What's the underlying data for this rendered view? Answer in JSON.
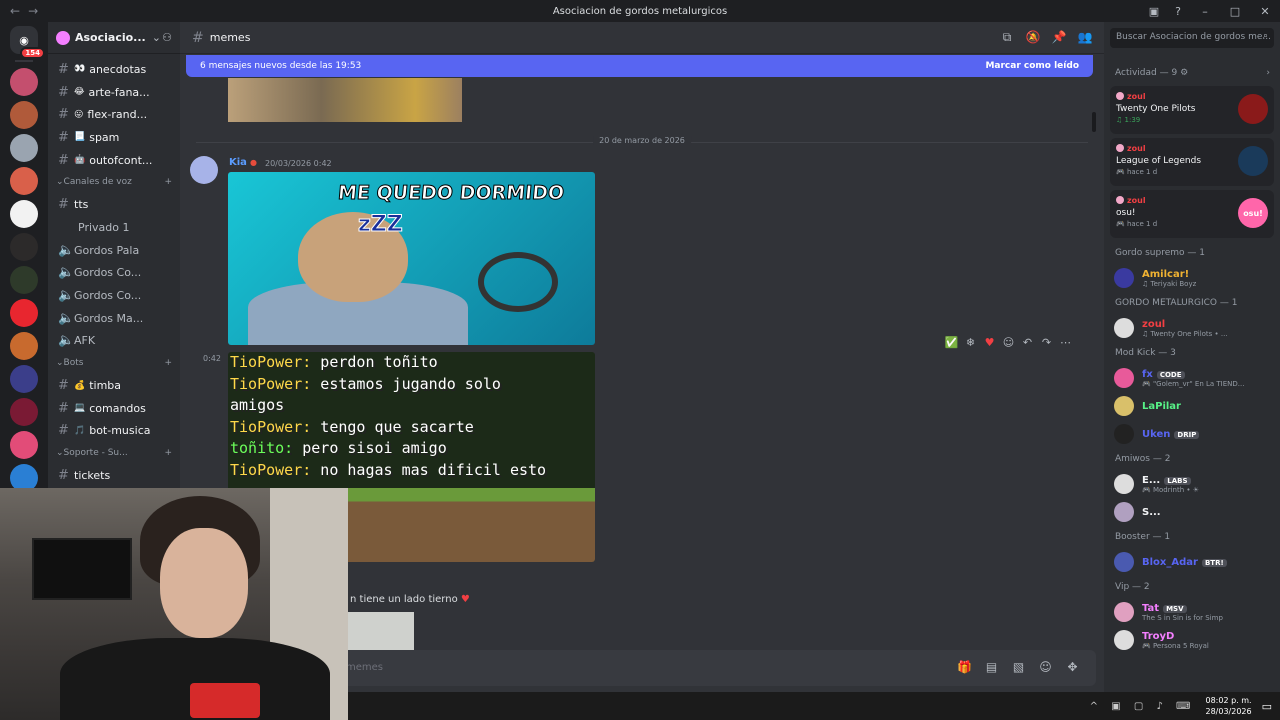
{
  "window": {
    "title": "Asociacion de gordos metalurgicos",
    "nav_back": "←",
    "nav_forward": "→"
  },
  "guilds": {
    "home_badge": "154",
    "colors": [
      "#c44f6e",
      "#b05a3a",
      "#9aa4b0",
      "#d9604a",
      "#f2f2f2",
      "#2c2a2a",
      "#2e3a2a",
      "#e8262f",
      "#c86a2e",
      "#3b3e8a",
      "#7a1a34",
      "#e24c78",
      "#2a7fd4"
    ]
  },
  "server": {
    "name": "Asociacio...",
    "channels": [
      {
        "emoji": "👀",
        "name": "anecdotas"
      },
      {
        "emoji": "😂",
        "name": "arte-fana..."
      },
      {
        "emoji": "😛",
        "name": "flex-rand..."
      },
      {
        "emoji": "📃",
        "name": "spam"
      },
      {
        "emoji": "🤖",
        "name": "outofcont..."
      }
    ],
    "voice_category": "Canales de voz",
    "voice_channels": [
      {
        "name": "tts",
        "type": "text"
      },
      {
        "name": "Privado 1",
        "type": "plain"
      },
      {
        "name": "Gordos Pala",
        "type": "voice"
      },
      {
        "name": "Gordos Co...",
        "type": "voice"
      },
      {
        "name": "Gordos Co...",
        "type": "voice"
      },
      {
        "name": "Gordos Ma...",
        "type": "voice"
      },
      {
        "name": "AFK",
        "type": "voice"
      }
    ],
    "bots_category": "Bots",
    "bots_channels": [
      {
        "emoji": "💰",
        "name": "timba"
      },
      {
        "emoji": "💻",
        "name": "comandos"
      },
      {
        "emoji": "🎵",
        "name": "bot-musica"
      }
    ],
    "support_category": "Soporte - Su...",
    "support_channels": [
      {
        "name": "tickets"
      }
    ]
  },
  "channel": {
    "name": "memes",
    "new_messages_text": "6 mensajes nuevos desde las 19:53",
    "mark_read": "Marcar como leído",
    "date_divider": "20 de marzo de 2026",
    "author": "Kia",
    "timestamp": "20/03/2026 0:42",
    "short_time": "0:42",
    "meme1_caption": "ME QUEDO DORMIDO",
    "meme1_zzz": "zZZ",
    "chat_lines": [
      {
        "name": "TioPower:",
        "text": " perdon toñito"
      },
      {
        "name": "TioPower:",
        "text": " estamos jugando solo"
      },
      {
        "name": "",
        "text": "amigos"
      },
      {
        "name": "TioPower:",
        "text": " tengo que sacarte"
      },
      {
        "name": "toñito:",
        "text": " pero sisoi amigo"
      },
      {
        "name": "TioPower:",
        "text": " no hagas mas dificil esto"
      }
    ],
    "message3": "n tiene un lado tierno",
    "message3_heart": "♥",
    "input_placeholder": "memes"
  },
  "members": {
    "search_placeholder": "Buscar Asociacion de gordos me...",
    "activity_header": "Actividad — 9",
    "activities": [
      {
        "name": "zoul",
        "title": "Twenty One Pilots",
        "sub": "♫ 1:39",
        "art_color": "#8a1a1a",
        "green": true
      },
      {
        "name": "zoul",
        "title": "League of Legends",
        "sub": "🎮 hace 1 d",
        "art_color": "#1a3a5a",
        "green": false
      },
      {
        "name": "zoul",
        "title": "osu!",
        "sub": "🎮 hace 1 d",
        "art_color": "#ff66aa",
        "green": false,
        "art_text": "osu!"
      }
    ],
    "groups": [
      {
        "header": "Gordo supremo — 1",
        "members": [
          {
            "name": "Amilcar!",
            "sub": "♫ Teriyaki Boyz",
            "color": "#f0b232",
            "av": "#3a3aa0",
            "badge": ""
          }
        ]
      },
      {
        "header": "GORDO METALURGICO — 1",
        "members": [
          {
            "name": "zoul",
            "sub": "♫ Twenty One Pilots • ...",
            "color": "#f23f43",
            "av": "#dddddd",
            "badge": ""
          }
        ]
      },
      {
        "header": "Mod Kick — 3",
        "members": [
          {
            "name": "fx",
            "sub": "🎮 \"Golem_vr\" En La TIEND...",
            "color": "#5865f2",
            "av": "#e85a9a",
            "badge": "CODE"
          },
          {
            "name": "LaPilar",
            "sub": "",
            "color": "#57f287",
            "av": "#d9c06a",
            "badge": ""
          },
          {
            "name": "Uken",
            "sub": "",
            "color": "#5865f2",
            "av": "#222222",
            "badge": "DRIP"
          }
        ]
      },
      {
        "header": "Amiwos — 2",
        "members": [
          {
            "name": "E...",
            "sub": "🎮 Modrinth • ☀",
            "color": "#f2f3f5",
            "av": "#dddddd",
            "badge": "LABS"
          },
          {
            "name": "S...",
            "sub": "",
            "color": "#f2f3f5",
            "av": "#b0a0c0",
            "badge": ""
          }
        ]
      },
      {
        "header": "Booster — 1",
        "members": [
          {
            "name": "Blox_Adar",
            "sub": "",
            "color": "#5865f2",
            "av": "#4a5ab0",
            "badge": "BTR!"
          }
        ]
      },
      {
        "header": "Vip — 2",
        "members": [
          {
            "name": "Tat",
            "sub": "The S in Sin is for Simp",
            "color": "#f47fff",
            "av": "#e0a0c0",
            "badge": "MSV"
          },
          {
            "name": "TroyD",
            "sub": "🎮 Persona 5 Royal",
            "color": "#f47fff",
            "av": "#dddddd",
            "badge": ""
          }
        ]
      }
    ]
  },
  "taskbar": {
    "time": "08:02 p. m.",
    "date": "28/03/2026"
  }
}
